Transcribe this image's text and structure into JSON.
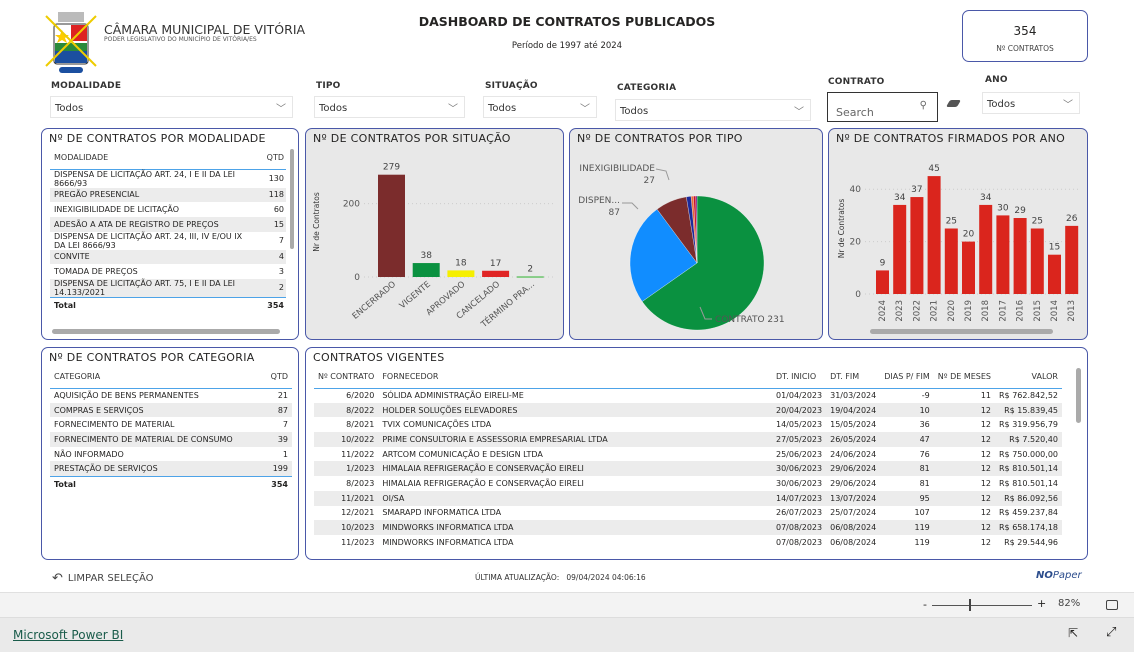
{
  "header": {
    "org_name": "CÂMARA MUNICIPAL DE VITÓRIA",
    "org_subtitle": "PODER LEGISLATIVO DO MUNICÍPIO DE VITÓRIA/ES",
    "title": "DASHBOARD DE CONTRATOS PUBLICADOS",
    "period": "Período de 1997 até 2024"
  },
  "kpi": {
    "value": "354",
    "label": "Nº CONTRATOS"
  },
  "filters": {
    "modalidade": {
      "label": "MODALIDADE",
      "value": "Todos"
    },
    "tipo": {
      "label": "TIPO",
      "value": "Todos"
    },
    "situacao": {
      "label": "SITUAÇÃO",
      "value": "Todos"
    },
    "categoria": {
      "label": "CATEGORIA",
      "value": "Todos"
    },
    "contrato": {
      "label": "CONTRATO",
      "placeholder": "Search"
    },
    "ano": {
      "label": "ANO",
      "value": "Todos"
    }
  },
  "modalidade_table": {
    "title": "Nº DE CONTRATOS POR MODALIDADE",
    "headers": [
      "MODALIDADE",
      "QTD"
    ],
    "rows": [
      [
        "DISPENSA DE LICITAÇÃO ART. 24, I E II DA LEI 8666/93",
        "130"
      ],
      [
        "PREGÃO PRESENCIAL",
        "118"
      ],
      [
        "INEXIGIBILIDADE DE LICITAÇÃO",
        "60"
      ],
      [
        "ADESÃO A ATA DE REGISTRO DE PREÇOS",
        "15"
      ],
      [
        "DISPENSA DE LICITAÇÃO ART. 24, III, IV E/OU IX DA LEI 8666/93",
        "7"
      ],
      [
        "CONVITE",
        "4"
      ],
      [
        "TOMADA DE PREÇOS",
        "3"
      ],
      [
        "DISPENSA DE LICITAÇÃO ART. 75, I E II DA LEI 14.133/2021",
        "2"
      ]
    ],
    "total_label": "Total",
    "total": "354"
  },
  "chart_data": [
    {
      "type": "bar",
      "title": "Nº DE CONTRATOS POR SITUAÇÃO",
      "ylabel": "Nr de Contratos",
      "ylim": [
        0,
        300
      ],
      "yticks": [
        0,
        200
      ],
      "categories": [
        "ENCERRADO",
        "VIGENTE",
        "APROVADO",
        "CANCELADO",
        "TÉRMINO PRA..."
      ],
      "values": [
        279,
        38,
        18,
        17,
        2
      ],
      "colors": [
        "#7b2c2c",
        "#0a9140",
        "#f5ef00",
        "#e02424",
        "#6cc56c"
      ],
      "grid": true
    },
    {
      "type": "pie",
      "title": "Nº DE CONTRATOS POR TIPO",
      "categories": [
        "CONTRATO",
        "DISPEN...",
        "INEXIGIBILIDADE",
        "",
        "",
        " ",
        ""
      ],
      "values": [
        231,
        87,
        27,
        4,
        2,
        2,
        1
      ],
      "colors": [
        "#0a9140",
        "#118dff",
        "#7b2c2c",
        "#1c2a9a",
        "#e66c37",
        "#c8102e",
        "#6b007b"
      ],
      "labels": [
        {
          "name": "CONTRATO",
          "value": "231"
        },
        {
          "name": "DISPEN...",
          "value": "87"
        },
        {
          "name": "INEXIGIBILIDADE",
          "value": "27"
        }
      ]
    },
    {
      "type": "bar",
      "title": "Nº DE CONTRATOS FIRMADOS POR ANO",
      "ylabel": "Nr de Contratos",
      "ylim": [
        0,
        50
      ],
      "yticks": [
        0,
        20,
        40
      ],
      "categories": [
        "2024",
        "2023",
        "2022",
        "2021",
        "2020",
        "2019",
        "2018",
        "2017",
        "2016",
        "2015",
        "2014",
        "2013"
      ],
      "values": [
        9,
        34,
        37,
        45,
        25,
        20,
        34,
        30,
        29,
        25,
        15,
        26
      ],
      "color": "#da251d",
      "grid": true
    }
  ],
  "categoria_table": {
    "title": "Nº DE CONTRATOS POR CATEGORIA",
    "headers": [
      "CATEGORIA",
      "QTD"
    ],
    "rows": [
      [
        "AQUISIÇÃO DE BENS PERMANENTES",
        "21"
      ],
      [
        "COMPRAS E SERVIÇOS",
        "87"
      ],
      [
        "FORNECIMENTO DE MATERIAL",
        "7"
      ],
      [
        "FORNECIMENTO DE MATERIAL DE CONSUMO",
        "39"
      ],
      [
        "NÃO INFORMADO",
        "1"
      ],
      [
        "PRESTAÇÃO DE SERVIÇOS",
        "199"
      ]
    ],
    "total_label": "Total",
    "total": "354"
  },
  "vigentes": {
    "title": "CONTRATOS VIGENTES",
    "headers": [
      "Nº CONTRATO",
      "FORNECEDOR",
      "DT. INICIO",
      "DT. FIM",
      "DIAS P/ FIM",
      "Nº DE MESES",
      "VALOR"
    ],
    "rows": [
      [
        "6/2020",
        "SÓLIDA ADMINISTRAÇÃO EIRELI-ME",
        "01/04/2023",
        "31/03/2024",
        "-9",
        "11",
        "R$ 762.842,52"
      ],
      [
        "8/2022",
        "HOLDER SOLUÇÕES ELEVADORES",
        "20/04/2023",
        "19/04/2024",
        "10",
        "12",
        "R$ 15.839,45"
      ],
      [
        "8/2021",
        "TVIX COMUNICAÇÕES LTDA",
        "14/05/2023",
        "15/05/2024",
        "36",
        "12",
        "R$ 319.956,79"
      ],
      [
        "10/2022",
        "PRIME CONSULTORIA E ASSESSORIA EMPRESARIAL LTDA",
        "27/05/2023",
        "26/05/2024",
        "47",
        "12",
        "R$ 7.520,40"
      ],
      [
        "11/2022",
        "ARTCOM COMUNICAÇÃO E DESIGN LTDA",
        "25/06/2023",
        "24/06/2024",
        "76",
        "12",
        "R$ 750.000,00"
      ],
      [
        "1/2023",
        "HIMALAIA REFRIGERAÇÃO E CONSERVAÇÃO EIRELI",
        "30/06/2023",
        "29/06/2024",
        "81",
        "12",
        "R$ 810.501,14"
      ],
      [
        "8/2023",
        "HIMALAIA REFRIGERAÇÃO E CONSERVAÇÃO EIRELI",
        "30/06/2023",
        "29/06/2024",
        "81",
        "12",
        "R$ 810.501,14"
      ],
      [
        "11/2021",
        "OI/SA",
        "14/07/2023",
        "13/07/2024",
        "95",
        "12",
        "R$ 86.092,56"
      ],
      [
        "12/2021",
        "SMARAPD INFORMATICA LTDA",
        "26/07/2023",
        "25/07/2024",
        "107",
        "12",
        "R$ 459.237,84"
      ],
      [
        "10/2023",
        "MINDWORKS INFORMATICA LTDA",
        "07/08/2023",
        "06/08/2024",
        "119",
        "12",
        "R$ 658.174,18"
      ],
      [
        "11/2023",
        "MINDWORKS INFORMATICA LTDA",
        "07/08/2023",
        "06/08/2024",
        "119",
        "12",
        "R$ 29.544,96"
      ]
    ]
  },
  "footer": {
    "clear_label": "LIMPAR SELEÇÃO",
    "update_label": "ÚLTIMA ATUALIZAÇÃO:",
    "update_value": "09/04/2024 04:06:16",
    "brand": "NOPaper"
  },
  "zoom": {
    "minus": "-",
    "plus": "+",
    "level": "82%",
    "percent": 82
  },
  "powerbi": {
    "link": "Microsoft Power BI"
  }
}
